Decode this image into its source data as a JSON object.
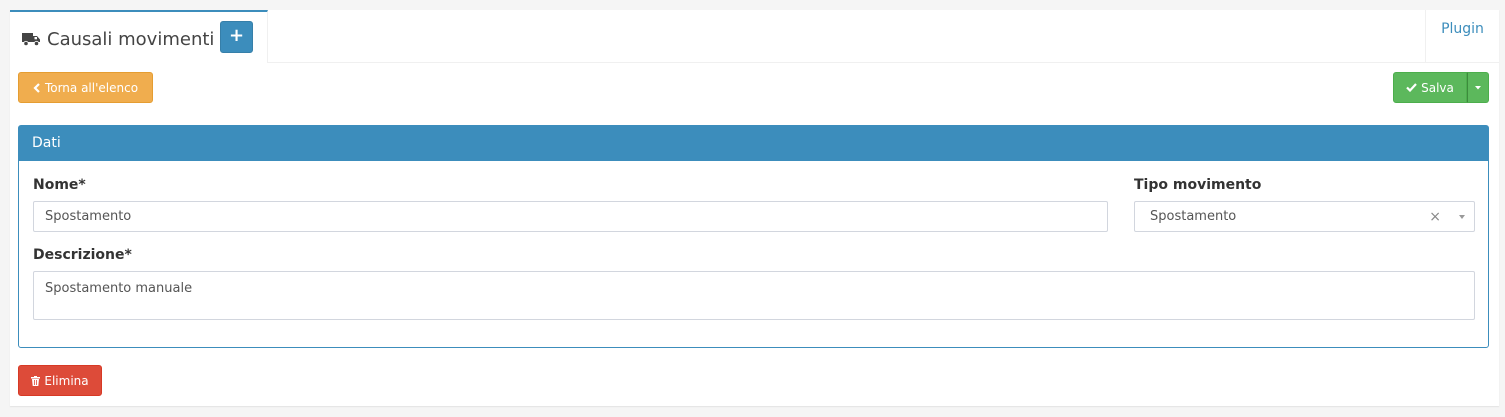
{
  "header": {
    "title": "Causali movimenti",
    "add_label": "+",
    "plugin_label": "Plugin"
  },
  "actions": {
    "back_label": "Torna all'elenco",
    "save_label": "Salva",
    "delete_label": "Elimina"
  },
  "panel": {
    "title": "Dati",
    "fields": {
      "nome": {
        "label": "Nome*",
        "value": "Spostamento"
      },
      "tipo": {
        "label": "Tipo movimento",
        "value": "Spostamento",
        "clear": "×"
      },
      "descrizione": {
        "label": "Descrizione*",
        "value": "Spostamento manuale"
      }
    }
  },
  "colors": {
    "primary": "#3c8dbc",
    "warning": "#f0ad4e",
    "success": "#5cb85c",
    "danger": "#dd4b39"
  },
  "icons": [
    "truck-icon",
    "plus-icon",
    "chevron-left-icon",
    "check-icon",
    "caret-down-icon",
    "trash-icon",
    "clear-icon"
  ]
}
